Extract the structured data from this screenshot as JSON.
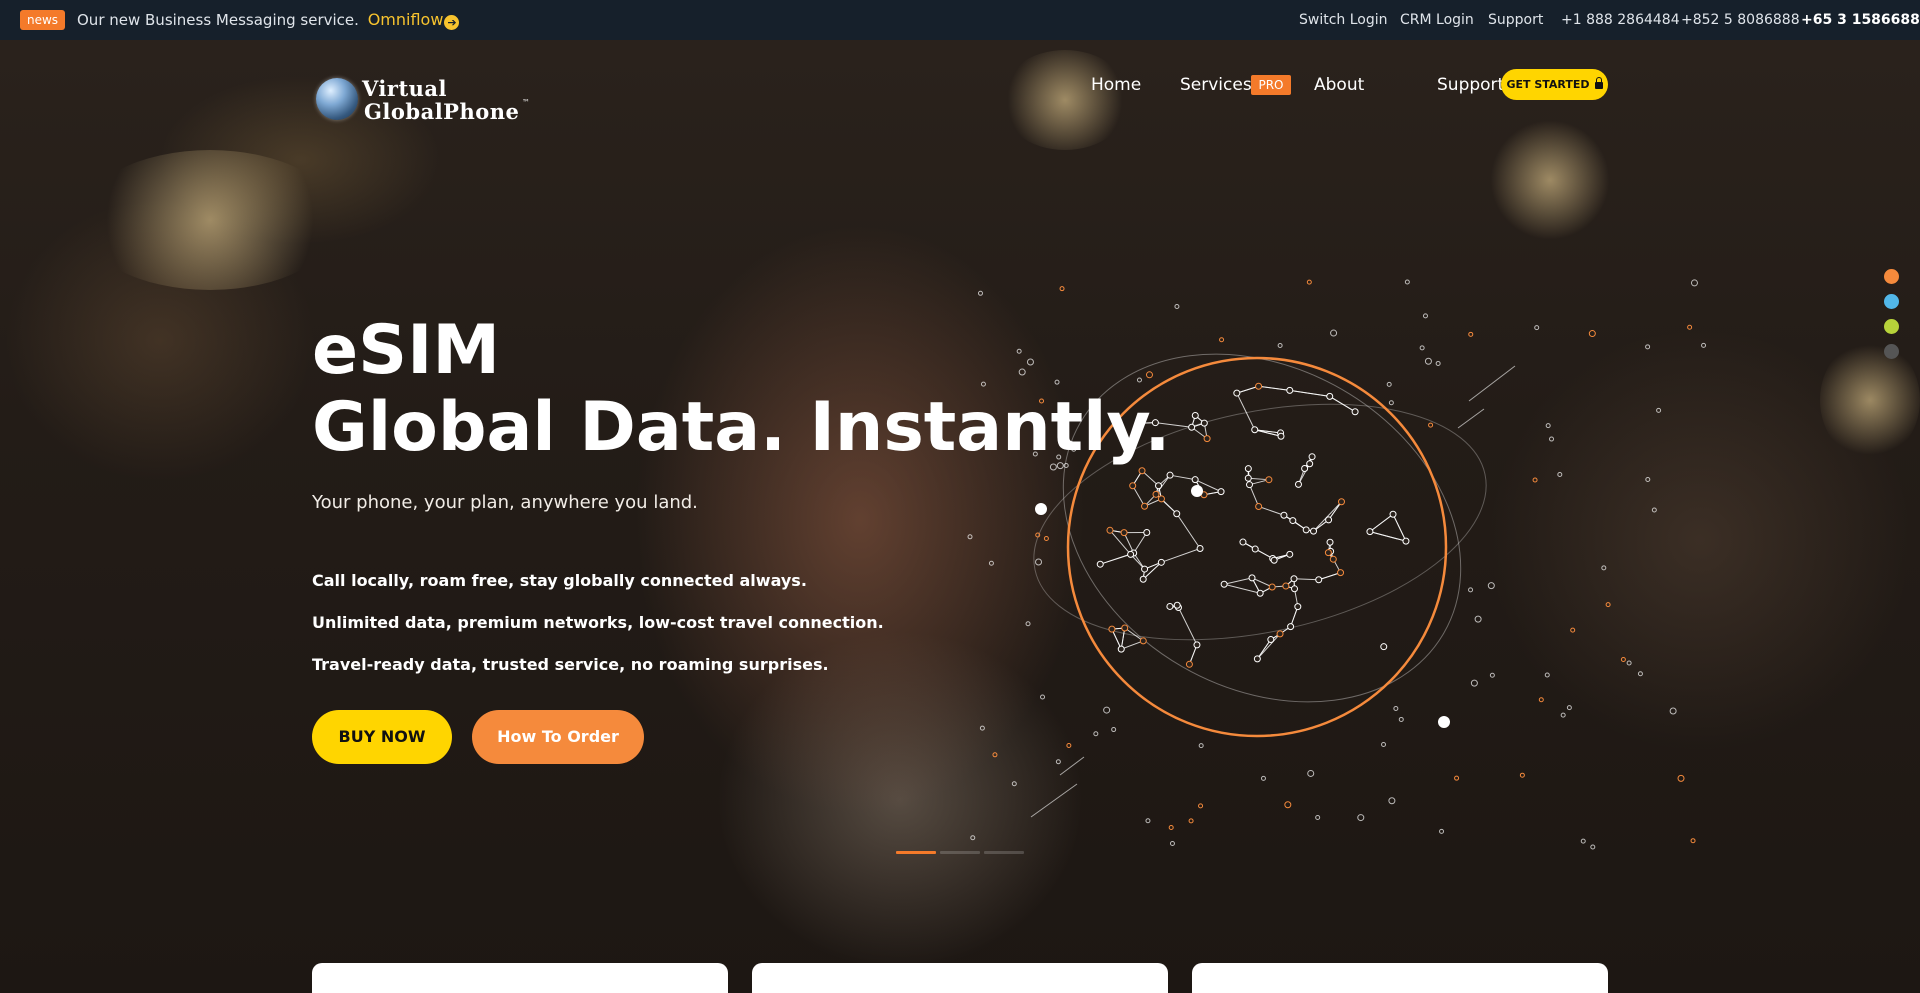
{
  "topbar": {
    "badge": "news",
    "message": "Our new Business Messaging service.",
    "link": "Omniflow",
    "links": [
      {
        "label": "Switch Login",
        "bold": false
      },
      {
        "label": "CRM Login",
        "bold": false
      },
      {
        "label": "Support",
        "bold": false
      },
      {
        "label": "+1 888 2864484",
        "bold": false
      },
      {
        "label": "+852 5 8086888",
        "bold": false
      },
      {
        "label": "+65 3 1586688",
        "bold": true
      }
    ]
  },
  "brand": {
    "line1": "Virtual",
    "line2": "GlobalPhone",
    "tm": "™"
  },
  "nav": {
    "items": [
      "Home",
      "Services",
      "About",
      "Support"
    ],
    "pro_badge": "PRO",
    "cta": "GET STARTED"
  },
  "hero": {
    "title_line1": "eSIM",
    "title_line2": "Global Data. Instantly.",
    "subtitle": "Your phone, your plan, anywhere you land.",
    "features": [
      "Call locally, roam free, stay globally connected always.",
      "Unlimited data, premium networks, low-cost travel connection.",
      "Travel-ready data, trusted service, no roaming surprises."
    ],
    "buy_button": "BUY NOW",
    "order_button": "How To Order"
  },
  "colors": {
    "accent_orange": "#f47a2a",
    "accent_yellow": "#ffd500",
    "topbar_bg": "#16202b",
    "side_dots": [
      "#f58a3c",
      "#52b7e8",
      "#b7d33a",
      "#555555"
    ]
  },
  "slider": {
    "active_index": 0,
    "count": 3
  },
  "cards": {
    "count": 3
  }
}
